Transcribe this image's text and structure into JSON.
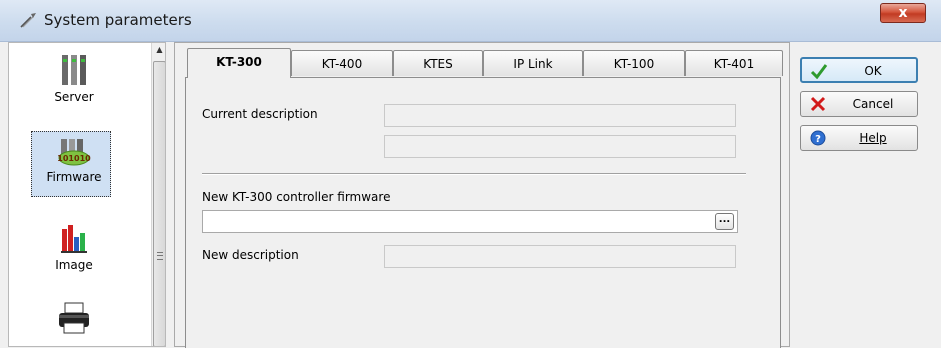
{
  "window": {
    "title": "System parameters",
    "close_label": "x"
  },
  "nav": {
    "items": [
      {
        "label": "Server",
        "icon": "server-icon"
      },
      {
        "label": "Firmware",
        "icon": "firmware-icon",
        "selected": true
      },
      {
        "label": "Image",
        "icon": "image-icon"
      },
      {
        "label": "",
        "icon": "printer-icon"
      }
    ]
  },
  "tabs": [
    {
      "label": "KT-300",
      "active": true
    },
    {
      "label": "KT-400"
    },
    {
      "label": "KTES"
    },
    {
      "label": "IP Link"
    },
    {
      "label": "KT-100"
    },
    {
      "label": "KT-401"
    }
  ],
  "form": {
    "current_description_label": "Current description",
    "current_description_value": "",
    "current_description_value2": "",
    "new_firmware_label": "New KT-300 controller firmware",
    "new_firmware_value": "",
    "browse_label": "...",
    "new_description_label": "New description",
    "new_description_value": ""
  },
  "buttons": {
    "ok": "OK",
    "cancel": "Cancel",
    "help": "Help"
  }
}
